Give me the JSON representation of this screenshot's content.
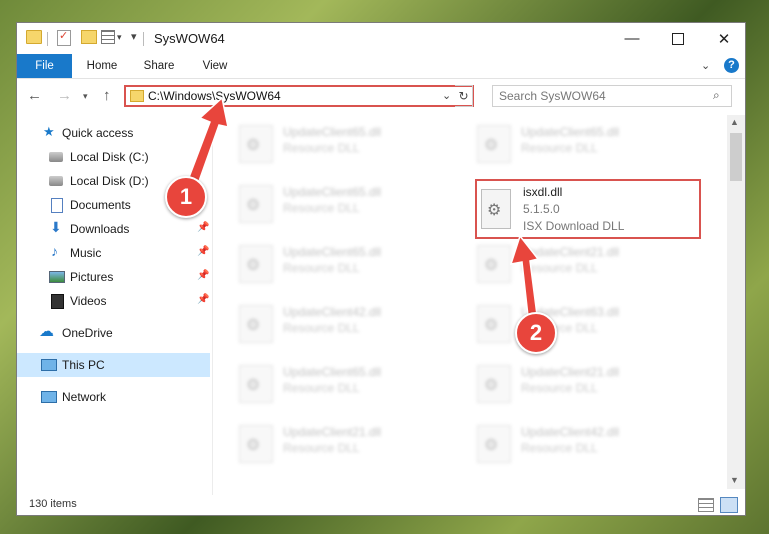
{
  "window": {
    "title": "SysWOW64"
  },
  "ribbon": {
    "file": "File",
    "home": "Home",
    "share": "Share",
    "view": "View"
  },
  "address": {
    "path": "C:\\Windows\\SysWOW64"
  },
  "search": {
    "placeholder": "Search SysWOW64"
  },
  "sidebar": {
    "items": [
      {
        "label": "Quick access"
      },
      {
        "label": "Local Disk (C:)"
      },
      {
        "label": "Local Disk (D:)"
      },
      {
        "label": "Documents"
      },
      {
        "label": "Downloads"
      },
      {
        "label": "Music"
      },
      {
        "label": "Pictures"
      },
      {
        "label": "Videos"
      },
      {
        "label": "OneDrive"
      },
      {
        "label": "This PC"
      },
      {
        "label": "Network"
      }
    ]
  },
  "files": [
    {
      "name": "UpdateClient65.dll",
      "type": "Resource DLL"
    },
    {
      "name": "UpdateClient65.dll",
      "type": "Resource DLL"
    },
    {
      "name": "UpdateClient65.dll",
      "type": "Resource DLL"
    },
    {
      "name": "UpdateClient65.dll",
      "type": "Resource DLL"
    },
    {
      "name": "UpdateClient21.dll",
      "type": "Resource DLL"
    },
    {
      "name": "UpdateClient42.dll",
      "type": "Resource DLL"
    },
    {
      "name": "UpdateClient63.dll",
      "type": "Resource DLL"
    },
    {
      "name": "UpdateClient65.dll",
      "type": "Resource DLL"
    },
    {
      "name": "UpdateClient21.dll",
      "type": "Resource DLL"
    },
    {
      "name": "UpdateClient21.dll",
      "type": "Resource DLL"
    },
    {
      "name": "UpdateClient42.dll",
      "type": "Resource DLL"
    }
  ],
  "highlighted_file": {
    "name": "isxdl.dll",
    "version": "5.1.5.0",
    "description": "ISX Download DLL"
  },
  "status": {
    "count": "130 items"
  },
  "callouts": {
    "one": "1",
    "two": "2"
  },
  "colors": {
    "accent": "#1979ca",
    "annotation_red": "#d9534f"
  }
}
